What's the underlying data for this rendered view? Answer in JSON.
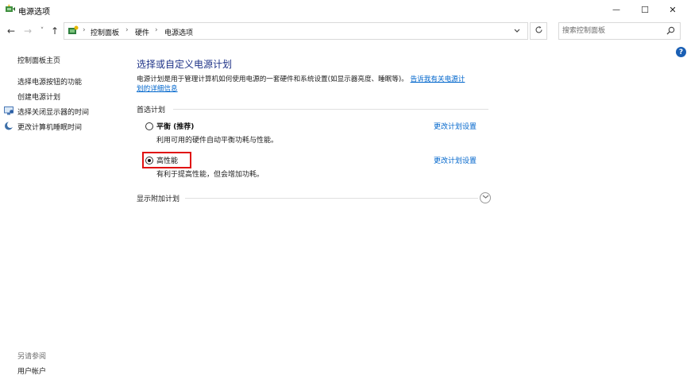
{
  "window": {
    "title": "电源选项",
    "minimize": "—",
    "maximize": "☐",
    "close": "✕"
  },
  "nav": {
    "back": "←",
    "forward": "→",
    "recent": "˅",
    "up": "↑",
    "breadcrumb": [
      "控制面板",
      "硬件",
      "电源选项"
    ],
    "separator": "›",
    "search_placeholder": "搜索控制面板"
  },
  "help": "?",
  "sidebar": {
    "home": "控制面板主页",
    "items": [
      {
        "label": "选择电源按钮的功能"
      },
      {
        "label": "创建电源计划"
      },
      {
        "label": "选择关闭显示器的时间"
      },
      {
        "label": "更改计算机睡眠时间"
      }
    ],
    "see_also_title": "另请参阅",
    "see_also": [
      {
        "label": "用户帐户"
      }
    ]
  },
  "main": {
    "title": "选择或自定义电源计划",
    "description": "电源计划是用于管理计算机如何使用电源的一套硬件和系统设置(如显示器亮度、睡眠等)。",
    "description_link_1": "告诉我有关电源计",
    "description_link_2": "划的详细信息",
    "preferred_heading": "首选计划",
    "plans": [
      {
        "name": "平衡 (推荐)",
        "desc": "利用可用的硬件自动平衡功耗与性能。",
        "link": "更改计划设置",
        "selected": false
      },
      {
        "name": "高性能",
        "desc": "有利于提高性能，但会增加功耗。",
        "link": "更改计划设置",
        "selected": true
      }
    ],
    "additional_heading": "显示附加计划"
  },
  "colors": {
    "title_blue": "#1e3287",
    "link_blue": "#0066cc",
    "highlight_red": "#e01010"
  }
}
